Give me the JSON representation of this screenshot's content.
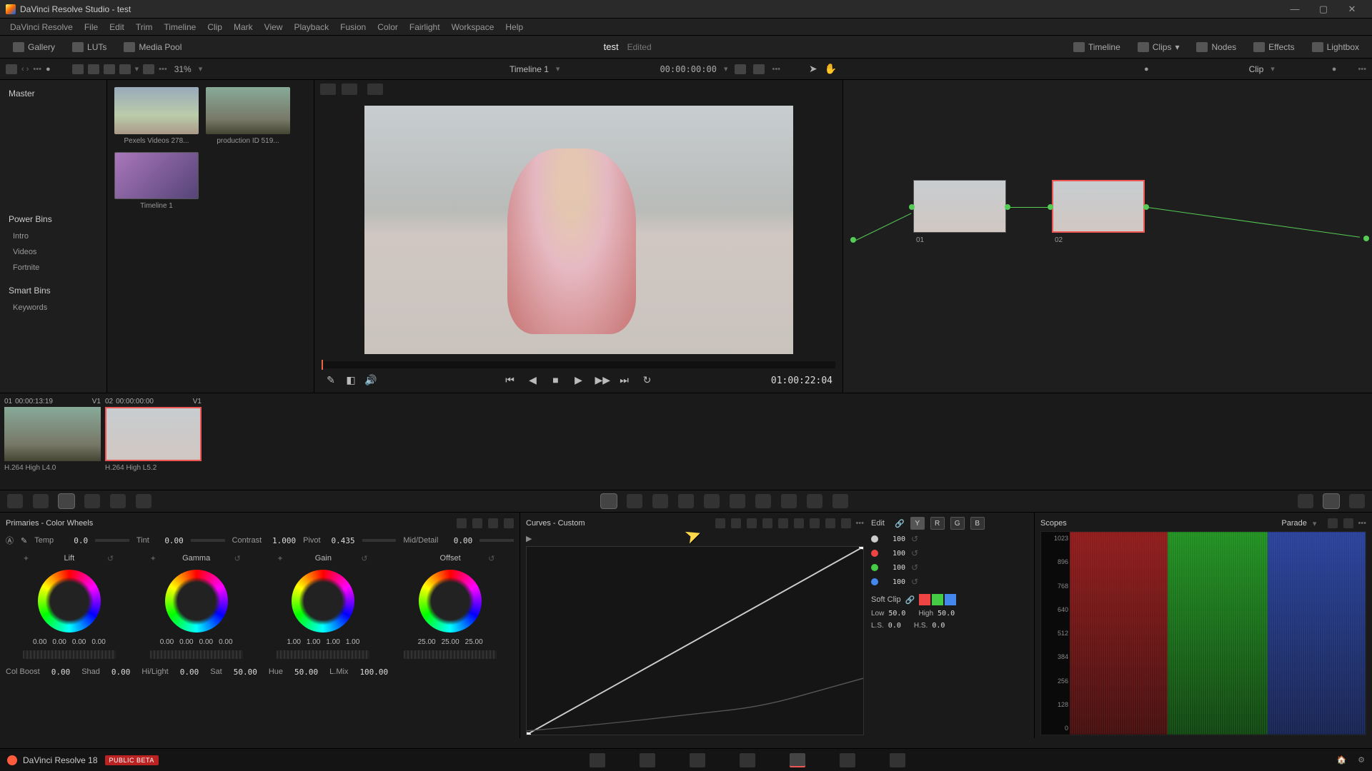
{
  "window": {
    "title": "DaVinci Resolve Studio - test"
  },
  "menus": [
    "DaVinci Resolve",
    "File",
    "Edit",
    "Trim",
    "Timeline",
    "Clip",
    "Mark",
    "View",
    "Playback",
    "Fusion",
    "Color",
    "Fairlight",
    "Workspace",
    "Help"
  ],
  "top_toolbar": {
    "left": [
      {
        "icon": "gallery-icon",
        "label": "Gallery"
      },
      {
        "icon": "luts-icon",
        "label": "LUTs"
      },
      {
        "icon": "mediapool-icon",
        "label": "Media Pool"
      }
    ],
    "project_title": "test",
    "edited_label": "Edited",
    "right": [
      {
        "icon": "timeline-icon",
        "label": "Timeline"
      },
      {
        "icon": "clips-icon",
        "label": "Clips"
      },
      {
        "icon": "nodes-icon",
        "label": "Nodes"
      },
      {
        "icon": "effects-icon",
        "label": "Effects"
      },
      {
        "icon": "lightbox-icon",
        "label": "Lightbox"
      }
    ]
  },
  "sub_toolbar": {
    "zoom": "31%",
    "timeline_name": "Timeline 1",
    "timecode": "00:00:00:00",
    "clip_label": "Clip"
  },
  "media_pool": {
    "master": "Master",
    "power_bins_hdr": "Power Bins",
    "power_bins": [
      "Intro",
      "Videos",
      "Fortnite"
    ],
    "smart_bins_hdr": "Smart Bins",
    "smart_bins": [
      "Keywords"
    ],
    "clips": [
      {
        "label": "Pexels Videos 278..."
      },
      {
        "label": "production ID 519..."
      },
      {
        "label": "Timeline 1"
      }
    ]
  },
  "viewer": {
    "end_tc": "01:00:22:04"
  },
  "nodes": {
    "n1": "01",
    "n2": "02"
  },
  "clip_strip": [
    {
      "idx": "01",
      "tc": "00:00:13:19",
      "track": "V1",
      "codec": "H.264 High L4.0"
    },
    {
      "idx": "02",
      "tc": "00:00:00:00",
      "track": "V1",
      "codec": "H.264 High L5.2"
    }
  ],
  "primaries": {
    "title": "Primaries - Color Wheels",
    "params": {
      "temp": {
        "label": "Temp",
        "val": "0.0"
      },
      "tint": {
        "label": "Tint",
        "val": "0.00"
      },
      "contrast": {
        "label": "Contrast",
        "val": "1.000"
      },
      "pivot": {
        "label": "Pivot",
        "val": "0.435"
      },
      "middetail": {
        "label": "Mid/Detail",
        "val": "0.00"
      }
    },
    "wheels": {
      "lift": {
        "label": "Lift",
        "vals": [
          "0.00",
          "0.00",
          "0.00",
          "0.00"
        ]
      },
      "gamma": {
        "label": "Gamma",
        "vals": [
          "0.00",
          "0.00",
          "0.00",
          "0.00"
        ]
      },
      "gain": {
        "label": "Gain",
        "vals": [
          "1.00",
          "1.00",
          "1.00",
          "1.00"
        ]
      },
      "offset": {
        "label": "Offset",
        "vals": [
          "25.00",
          "25.00",
          "25.00"
        ]
      }
    },
    "adjust": {
      "colboost": {
        "label": "Col Boost",
        "val": "0.00"
      },
      "shad": {
        "label": "Shad",
        "val": "0.00"
      },
      "hilight": {
        "label": "Hi/Light",
        "val": "0.00"
      },
      "sat": {
        "label": "Sat",
        "val": "50.00"
      },
      "hue": {
        "label": "Hue",
        "val": "50.00"
      },
      "lmix": {
        "label": "L.Mix",
        "val": "100.00"
      }
    }
  },
  "curves": {
    "title": "Curves - Custom",
    "edit_label": "Edit",
    "channels": [
      "Y",
      "R",
      "G",
      "B"
    ],
    "intensity": {
      "w": "100",
      "r": "100",
      "g": "100",
      "b": "100"
    },
    "softclip": {
      "label": "Soft Clip",
      "low_l": "Low",
      "low_v": "50.0",
      "high_l": "High",
      "high_v": "50.0",
      "ls_l": "L.S.",
      "ls_v": "0.0",
      "hs_l": "H.S.",
      "hs_v": "0.0"
    }
  },
  "scopes": {
    "title": "Scopes",
    "mode": "Parade",
    "ticks": [
      "1023",
      "896",
      "768",
      "640",
      "512",
      "384",
      "256",
      "128",
      "0"
    ]
  },
  "footer": {
    "app": "DaVinci Resolve 18",
    "beta": "PUBLIC BETA"
  }
}
